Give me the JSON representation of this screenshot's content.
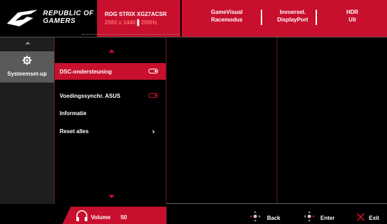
{
  "brand": {
    "line1": "REPUBLIC OF",
    "line2": "GAMERS"
  },
  "model": {
    "name": "ROG STRIX",
    "model_code": "XG27ACSR",
    "resolution": "2560 x 1440",
    "refresh": "200Hz"
  },
  "status": [
    {
      "label": "GameVisual",
      "value": "Racemodus"
    },
    {
      "label": "Invoersel.",
      "value": "DisplayPort"
    },
    {
      "label": "HDR",
      "value": "Uit"
    }
  ],
  "sidebar": {
    "items": [
      {
        "label": "Systeemset-up",
        "icon": "gear-icon"
      }
    ]
  },
  "menu": {
    "items": [
      {
        "label": "DSC-ondersteuning",
        "control": "toggle",
        "state": "on"
      },
      {
        "label": "Voedingssynchr. ASUS",
        "control": "toggle",
        "state": "on"
      },
      {
        "label": "Informatie"
      },
      {
        "label": "Reset alles",
        "control": "chevron",
        "symbol": "›"
      }
    ]
  },
  "footer": {
    "volume_label": "Volume",
    "volume_value": "50",
    "back_label": "Back",
    "enter_label": "Enter",
    "exit_label": "Exit"
  },
  "colors": {
    "accent": "#c8102e",
    "sidebar_selected": "#5a5a5a",
    "background": "#000000"
  }
}
